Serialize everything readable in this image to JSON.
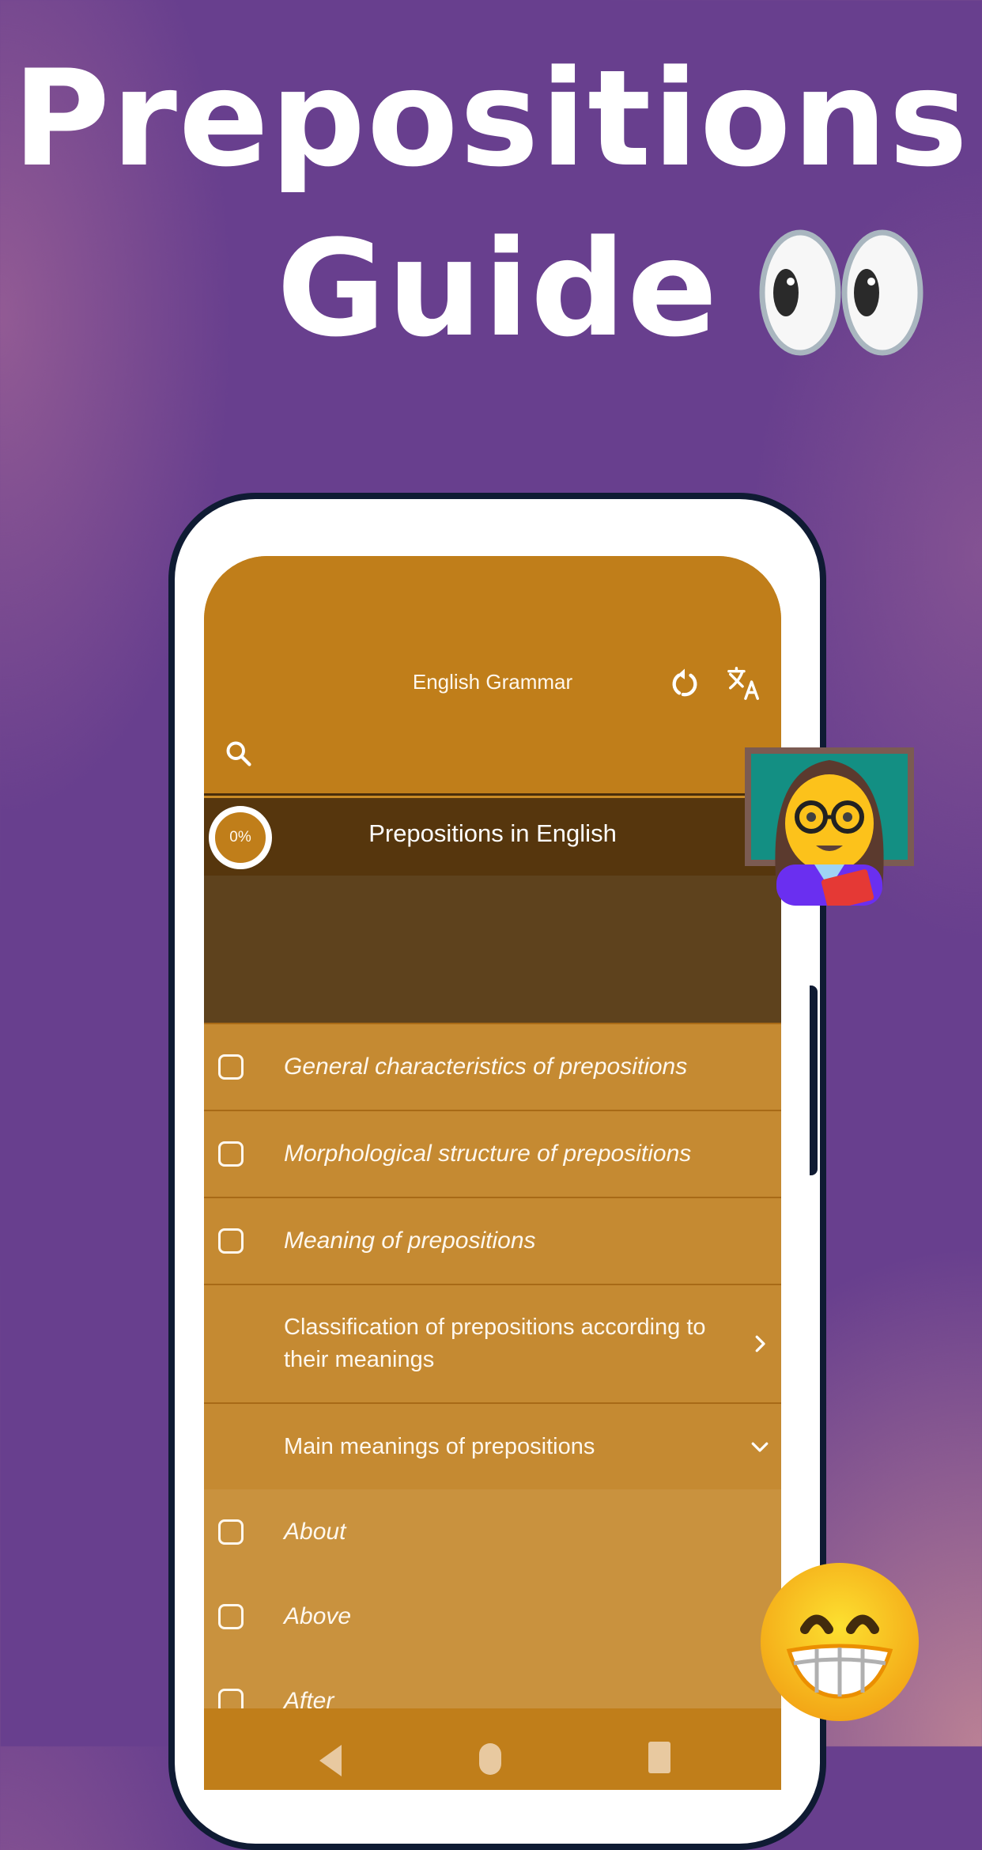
{
  "promo": {
    "headline_line1": "Prepositions",
    "headline_line2": "Guide",
    "decorations": [
      "eyes-emoji",
      "woman-teacher-emoji",
      "grinning-face-emoji"
    ]
  },
  "app": {
    "title": "English Grammar",
    "icons": {
      "refresh": "refresh-icon",
      "translate": "translate-icon",
      "search": "search-icon"
    },
    "search_placeholder": ""
  },
  "section": {
    "progress": "0%",
    "title": "Prepositions in English"
  },
  "list": {
    "items": [
      {
        "label": "General characteristics of prepositions",
        "checked": false
      },
      {
        "label": "Morphological structure of prepositions",
        "checked": false
      },
      {
        "label": "Meaning of prepositions",
        "checked": false
      }
    ],
    "groups": [
      {
        "label": "Classification of prepositions according to their meanings",
        "state": "collapsed"
      },
      {
        "label": "Main meanings of prepositions",
        "state": "expanded"
      }
    ],
    "sub_items": [
      {
        "label": "About",
        "checked": false
      },
      {
        "label": "Above",
        "checked": false
      },
      {
        "label": "After",
        "checked": false
      }
    ]
  },
  "system_nav": {
    "back": "back-icon",
    "home": "home-icon",
    "recents": "recents-icon"
  },
  "colors": {
    "background": "#683f8e",
    "app_primary": "#c07e1a",
    "header_dark": "#56360d",
    "banner": "#5e421d",
    "row": "#c58a32",
    "sub_row": "#c9923e",
    "phone_frame": "#0f1b33"
  }
}
